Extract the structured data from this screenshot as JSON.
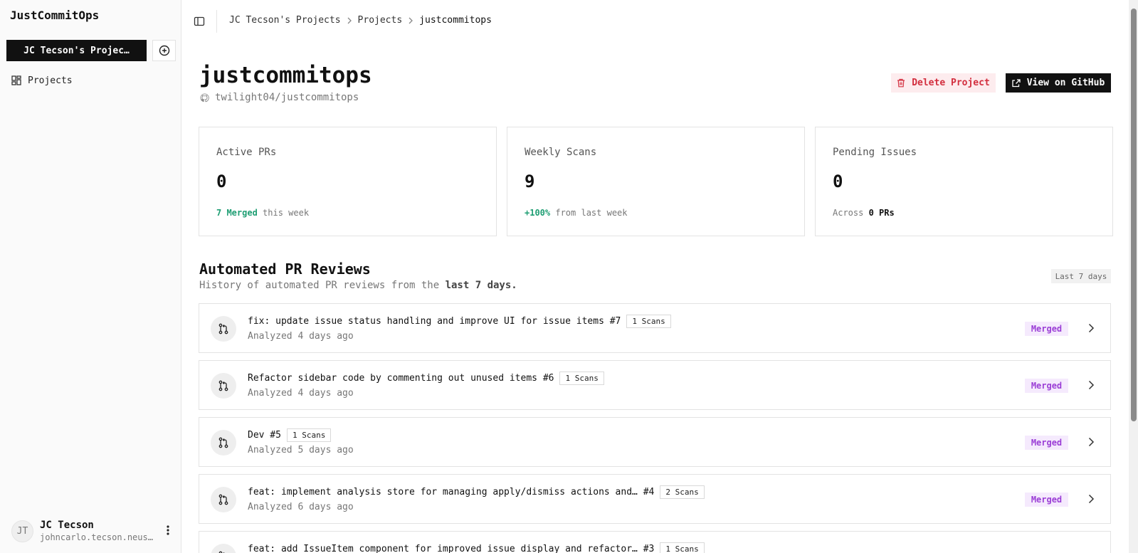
{
  "sidebar": {
    "brand": "JustCommitOps",
    "team_button": "JC Tecson's Projec…",
    "add_icon": "plus-circle-icon",
    "nav_items": [
      {
        "label": "Projects",
        "icon": "dashboard-icon"
      }
    ],
    "user": {
      "initials": "JT",
      "name": "JC Tecson",
      "email": "johncarlo.tecson.neus…"
    }
  },
  "topbar": {
    "breadcrumb": [
      "JC Tecson's Projects",
      "Projects",
      "justcommitops"
    ]
  },
  "header": {
    "title": "justcommitops",
    "repo": "twilight04/justcommitops",
    "delete_label": "Delete Project",
    "github_label": "View on GitHub"
  },
  "stats": [
    {
      "label": "Active PRs",
      "value": "0",
      "highlight": "7 Merged",
      "rest": " this week"
    },
    {
      "label": "Weekly Scans",
      "value": "9",
      "highlight": "+100%",
      "rest": " from last week"
    },
    {
      "label": "Pending Issues",
      "value": "0",
      "prefix": "Across ",
      "strong": "0 PRs"
    }
  ],
  "reviews": {
    "title": "Automated PR Reviews",
    "subtitle_prefix": "History of automated PR reviews from the ",
    "subtitle_strong": "last 7 days.",
    "range_badge": "Last 7 days",
    "items": [
      {
        "title": "fix: update issue status handling and improve UI for issue items #7",
        "scans": "1 Scans",
        "analyzed": "Analyzed 4 days ago",
        "status": "Merged"
      },
      {
        "title": "Refactor sidebar code by commenting out unused items #6",
        "scans": "1 Scans",
        "analyzed": "Analyzed 4 days ago",
        "status": "Merged"
      },
      {
        "title": "Dev #5",
        "scans": "1 Scans",
        "analyzed": "Analyzed 5 days ago",
        "status": "Merged"
      },
      {
        "title": "feat: implement analysis store for managing apply/dismiss actions and… #4",
        "scans": "2 Scans",
        "analyzed": "Analyzed 6 days ago",
        "status": "Merged"
      },
      {
        "title": "feat: add IssueItem component for improved issue display and refactor… #3",
        "scans": "1 Scans",
        "analyzed": "",
        "status": ""
      }
    ]
  },
  "colors": {
    "accent_green": "#1e9e73",
    "merged_purple": "#9b3ed6",
    "danger_red": "#d32f3f"
  }
}
